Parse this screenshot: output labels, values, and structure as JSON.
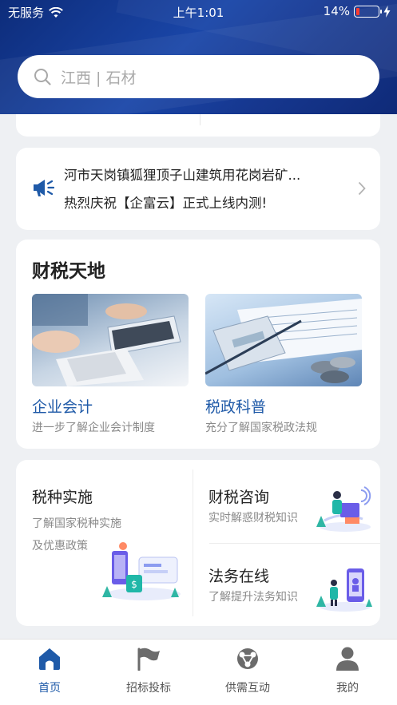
{
  "status_bar": {
    "carrier": "无服务",
    "time": "上午1:01",
    "battery": "14%",
    "battery_level": 0.14
  },
  "search": {
    "placeholder": "江西 | 石材",
    "icon": "search-icon"
  },
  "news": {
    "line1": "河市天岗镇狐狸顶子山建筑用花岗岩矿...",
    "line2": "热烈庆祝【企富云】正式上线内测!",
    "icon": "megaphone-icon"
  },
  "tax_world": {
    "title": "财税天地",
    "items": [
      {
        "title": "企业会计",
        "subtitle": "进一步了解企业会计制度"
      },
      {
        "title": "税政科普",
        "subtitle": "充分了解国家税政法规"
      }
    ]
  },
  "services": {
    "left": {
      "title": "税种实施",
      "desc1": "了解国家税种实施",
      "desc2": "及优惠政策"
    },
    "right_top": {
      "title": "财税咨询",
      "desc": "实时解惑财税知识"
    },
    "right_bottom": {
      "title": "法务在线",
      "desc": "了解提升法务知识"
    }
  },
  "tabbar": {
    "tabs": [
      {
        "label": "首页",
        "icon": "home-icon",
        "active": true
      },
      {
        "label": "招标投标",
        "icon": "flag-icon",
        "active": false
      },
      {
        "label": "供需互动",
        "icon": "exchange-icon",
        "active": false
      },
      {
        "label": "我的",
        "icon": "user-icon",
        "active": false
      }
    ]
  },
  "colors": {
    "brand": "#1f5aa8",
    "header": "#1a46a8",
    "battery_low": "#ff3b30"
  }
}
